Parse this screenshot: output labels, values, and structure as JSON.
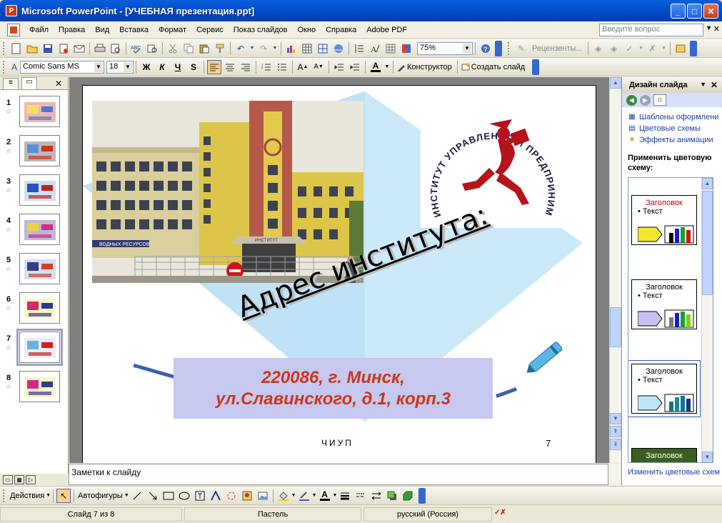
{
  "window": {
    "title": "Microsoft PowerPoint - [УЧЕБНАЯ презентация.ppt]",
    "minimize": "_",
    "maximize": "□",
    "close": "✕"
  },
  "menu": {
    "items": [
      "Файл",
      "Правка",
      "Вид",
      "Вставка",
      "Формат",
      "Сервис",
      "Показ слайдов",
      "Окно",
      "Справка",
      "Adobe PDF"
    ],
    "help_placeholder": "Введите вопрос",
    "close": "✕"
  },
  "toolbar1": {
    "zoom": "75%",
    "review": "Рецензенты..."
  },
  "toolbar2": {
    "font": "Comic Sans MS",
    "size": "18",
    "bold": "Ж",
    "italic": "К",
    "underline": "Ч",
    "shadow": "S",
    "designer": "Конструктор",
    "new_slide": "Создать слайд"
  },
  "slides_panel": {
    "slides": [
      {
        "num": "1"
      },
      {
        "num": "2"
      },
      {
        "num": "3"
      },
      {
        "num": "4"
      },
      {
        "num": "5"
      },
      {
        "num": "6"
      },
      {
        "num": "7"
      },
      {
        "num": "8"
      }
    ],
    "selected": "7"
  },
  "slide": {
    "logo_text": "ИНСТИТУТ УПРАВЛЕНИЯ И ПРЕДПРИНИМАТЕЛЬСТВА",
    "building_sign_1": "ВОДНЫХ РЕСУРСОВ",
    "building_sign_2": "ИНСТИТУТ",
    "heading": "Адрес института:",
    "address_line1": "220086, г. Минск,",
    "address_line2": "ул.Славинского, д.1, корп.3",
    "footer": "ЧИУП",
    "page_number": "7",
    "colors": {
      "address_bg": "#c7c8f0",
      "address_text": "#c9371a",
      "diamond": "#cce9f9",
      "logo_red": "#b5121b"
    }
  },
  "notes": {
    "placeholder": "Заметки к слайду"
  },
  "task_pane": {
    "title": "Дизайн слайда",
    "links": [
      {
        "label": "Шаблоны оформлени",
        "icon": "template-icon"
      },
      {
        "label": "Цветовые схемы",
        "icon": "color-scheme-icon"
      },
      {
        "label": "Эффекты анимации",
        "icon": "animation-icon"
      }
    ],
    "apply_label": "Применить цветовую схему:",
    "schemes": [
      {
        "title": "Заголовок",
        "text": "Текст",
        "title_color": "#cc0000"
      },
      {
        "title": "Заголовок",
        "text": "Текст",
        "title_color": "#000000"
      },
      {
        "title": "Заголовок",
        "text": "Текст",
        "title_color": "#000000"
      },
      {
        "title": "Заголовок"
      }
    ],
    "bottom_link": "Изменить цветовые схем"
  },
  "drawbar": {
    "actions": "Действия",
    "autoshapes": "Автофигуры"
  },
  "status": {
    "slide": "Слайд 7 из 8",
    "design": "Пастель",
    "language": "русский (Россия)"
  }
}
